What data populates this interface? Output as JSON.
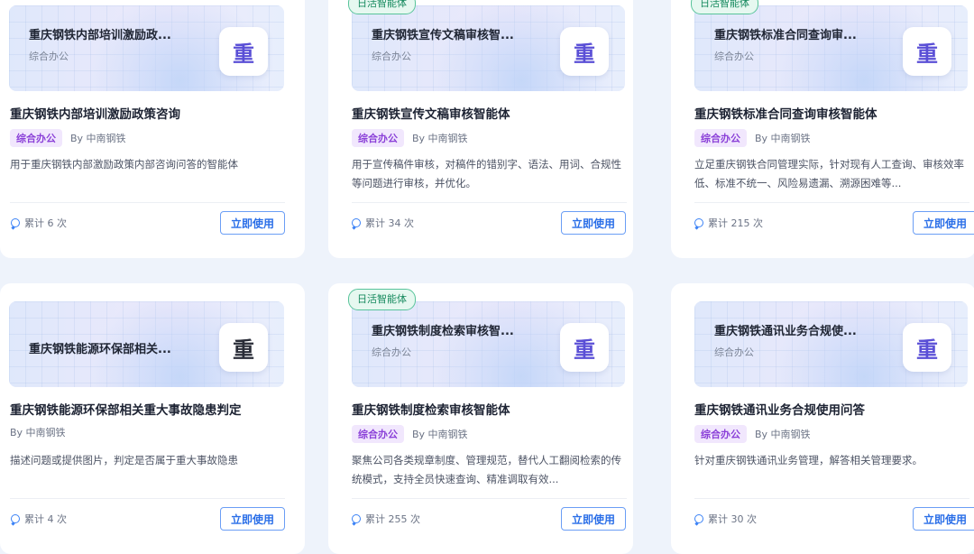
{
  "cards": [
    {
      "daily_badge": "",
      "banner_title": "重庆钢铁内部培训激励政...",
      "banner_sub": "综合办公",
      "avatar_char": "重",
      "title": "重庆钢铁内部培训激励政策咨询",
      "tag": "综合办公",
      "author": "By 中南钢铁",
      "desc": "用于重庆钢铁内部激励政策内部咨询问答的智能体",
      "count": "累计 6 次",
      "button": "立即使用"
    },
    {
      "daily_badge": "日活智能体",
      "banner_title": "重庆钢铁宣传文稿审核智...",
      "banner_sub": "综合办公",
      "avatar_char": "重",
      "title": "重庆钢铁宣传文稿审核智能体",
      "tag": "综合办公",
      "author": "By 中南钢铁",
      "desc": "用于宣传稿件审核，对稿件的错别字、语法、用词、合规性等问题进行审核，并优化。",
      "count": "累计 34 次",
      "button": "立即使用"
    },
    {
      "daily_badge": "日活智能体",
      "banner_title": "重庆钢铁标准合同查询审...",
      "banner_sub": "综合办公",
      "avatar_char": "重",
      "title": "重庆钢铁标准合同查询审核智能体",
      "tag": "综合办公",
      "author": "By 中南钢铁",
      "desc": "立足重庆钢铁合同管理实际，针对现有人工查询、审核效率低、标准不统一、风险易遗漏、溯源困难等...",
      "count": "累计 215 次",
      "button": "立即使用"
    },
    {
      "daily_badge": "",
      "banner_title": "重庆钢铁能源环保部相关...",
      "banner_sub": "",
      "avatar_char": "重",
      "title": "重庆钢铁能源环保部相关重大事故隐患判定",
      "tag": "",
      "author": "By 中南钢铁",
      "desc": "描述问题或提供图片，判定是否属于重大事故隐患",
      "count": "累计 4 次",
      "button": "立即使用"
    },
    {
      "daily_badge": "日活智能体",
      "banner_title": "重庆钢铁制度检索审核智...",
      "banner_sub": "综合办公",
      "avatar_char": "重",
      "title": "重庆钢铁制度检索审核智能体",
      "tag": "综合办公",
      "author": "By 中南钢铁",
      "desc": "聚焦公司各类规章制度、管理规范，替代人工翻阅检索的传统模式，支持全员快速查询、精准调取有效...",
      "count": "累计 255 次",
      "button": "立即使用"
    },
    {
      "daily_badge": "",
      "banner_title": "重庆钢铁通讯业务合规使...",
      "banner_sub": "综合办公",
      "avatar_char": "重",
      "title": "重庆钢铁通讯业务合规使用问答",
      "tag": "综合办公",
      "author": "By 中南钢铁",
      "desc": "针对重庆钢铁通讯业务管理，解答相关管理要求。",
      "count": "累计 30 次",
      "button": "立即使用"
    }
  ]
}
